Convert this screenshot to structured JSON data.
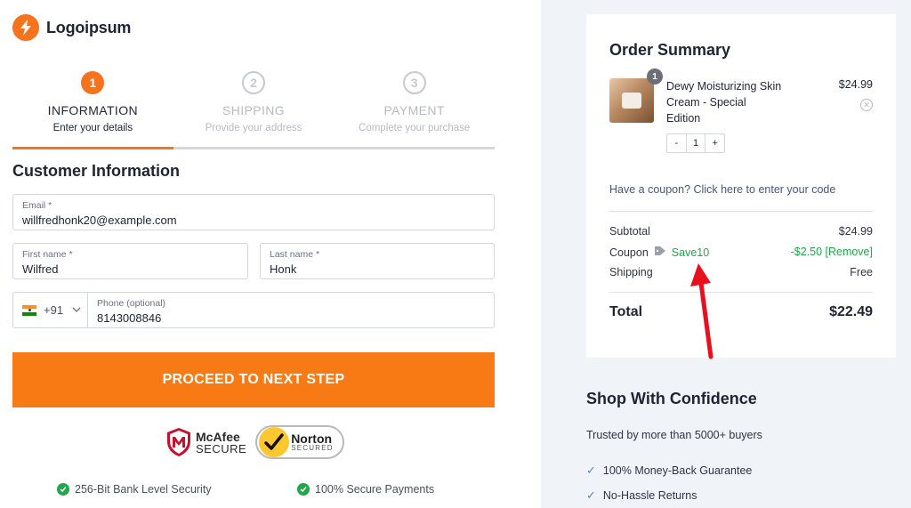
{
  "brand": {
    "name": "Logoipsum"
  },
  "steps": [
    {
      "number": "1",
      "title": "INFORMATION",
      "subtitle": "Enter your details",
      "state": "active"
    },
    {
      "number": "2",
      "title": "SHIPPING",
      "subtitle": "Provide your address",
      "state": "inactive"
    },
    {
      "number": "3",
      "title": "PAYMENT",
      "subtitle": "Complete your purchase",
      "state": "inactive"
    }
  ],
  "customer": {
    "title": "Customer Information",
    "email": {
      "label": "Email *",
      "value": "willfredhonk20@example.com"
    },
    "first_name": {
      "label": "First name *",
      "value": "Wilfred"
    },
    "last_name": {
      "label": "Last name *",
      "value": "Honk"
    },
    "phone": {
      "country_code": "+91",
      "label": "Phone (optional)",
      "value": "8143008846"
    }
  },
  "cta": {
    "label": "PROCEED TO NEXT STEP"
  },
  "badges": {
    "mcafee": {
      "name": "McAfee",
      "sub": "SECURE"
    },
    "norton": {
      "name": "Norton",
      "sub": "SECURED"
    }
  },
  "trust": [
    {
      "label": "256-Bit Bank Level Security"
    },
    {
      "label": "100% Secure Payments"
    }
  ],
  "summary": {
    "title": "Order Summary",
    "item": {
      "name": "Dewy Moisturizing Skin Cream - Special Edition",
      "price": "$24.99",
      "quantity_badge": "1",
      "quantity": "1",
      "minus": "-",
      "plus": "+"
    },
    "coupon_prompt": "Have a coupon? Click here to enter your code",
    "subtotal": {
      "label": "Subtotal",
      "value": "$24.99"
    },
    "coupon": {
      "label": "Coupon",
      "code": "Save10",
      "amount": "-$2.50 [Remove]"
    },
    "shipping": {
      "label": "Shipping",
      "value": "Free"
    },
    "total": {
      "label": "Total",
      "value": "$22.49"
    }
  },
  "confidence": {
    "title": "Shop With Confidence",
    "subtitle": "Trusted by more than 5000+ buyers",
    "items": [
      {
        "label": "100% Money-Back Guarantee"
      },
      {
        "label": "No-Hassle Returns"
      }
    ]
  },
  "colors": {
    "accent": "#f77a14",
    "success": "#1fa84a",
    "annotation_arrow": "#e8101c"
  }
}
